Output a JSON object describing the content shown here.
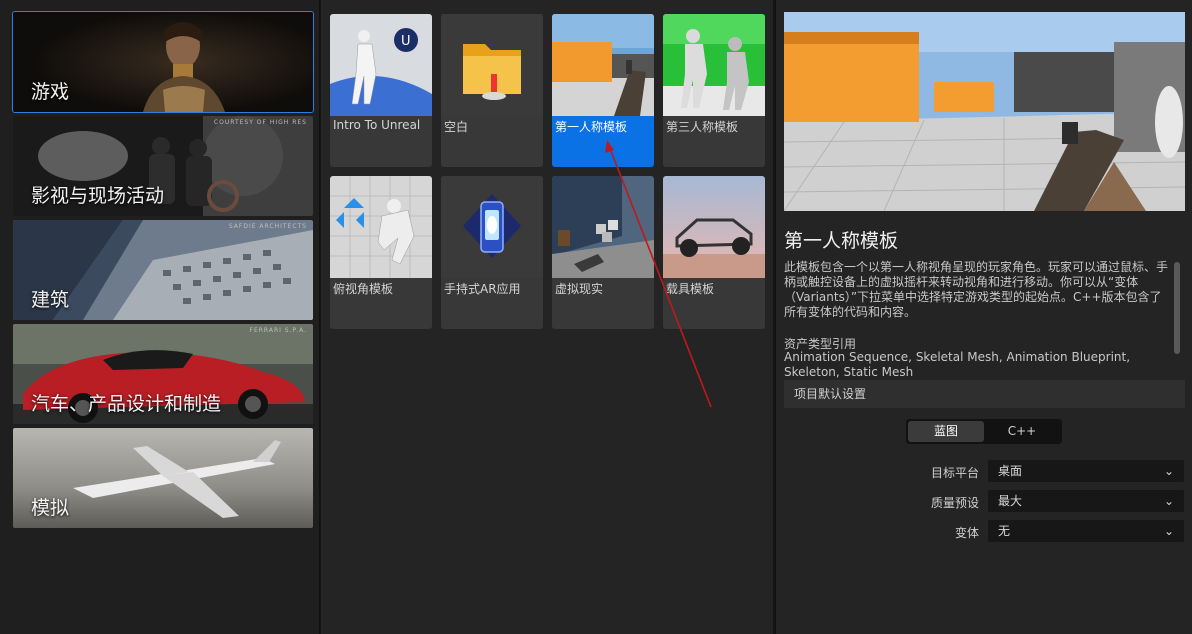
{
  "categories": [
    {
      "label": "游戏",
      "credit": ""
    },
    {
      "label": "影视与现场活动",
      "credit": "COURTESY OF HIGH RES"
    },
    {
      "label": "建筑",
      "credit": "SAFDIE ARCHITECTS"
    },
    {
      "label": "汽车、产品设计和制造",
      "credit": "FERRARI S.P.A."
    },
    {
      "label": "模拟",
      "credit": ""
    }
  ],
  "templates": [
    {
      "label": "Intro To Unreal"
    },
    {
      "label": "空白"
    },
    {
      "label": "第一人称模板"
    },
    {
      "label": "第三人称模板"
    },
    {
      "label": "俯视角模板"
    },
    {
      "label": "手持式AR应用"
    },
    {
      "label": "虚拟现实"
    },
    {
      "label": "载具模板"
    }
  ],
  "detail": {
    "title": "第一人称模板",
    "description": "此模板包含一个以第一人称视角呈现的玩家角色。玩家可以通过鼠标、手柄或触控设备上的虚拟摇杆来转动视角和进行移动。你可以从“变体（Variants）”下拉菜单中选择特定游戏类型的起始点。C++版本包含了所有变体的代码和内容。",
    "assets_heading": "资产类型引用",
    "assets": "Animation Sequence, Skeletal Mesh, Animation Blueprint, Skeleton, Static Mesh",
    "settings_heading": "项目默认设置",
    "lang_blueprint": "蓝图",
    "lang_cpp": "C++",
    "target_label": "目标平台",
    "target_value": "桌面",
    "quality_label": "质量预设",
    "quality_value": "最大",
    "variant_label": "变体",
    "variant_value": "无",
    "chevron": "⌄"
  },
  "colors": {
    "accent": "#0b72e6",
    "annotation_arrow": "#c0191d"
  }
}
